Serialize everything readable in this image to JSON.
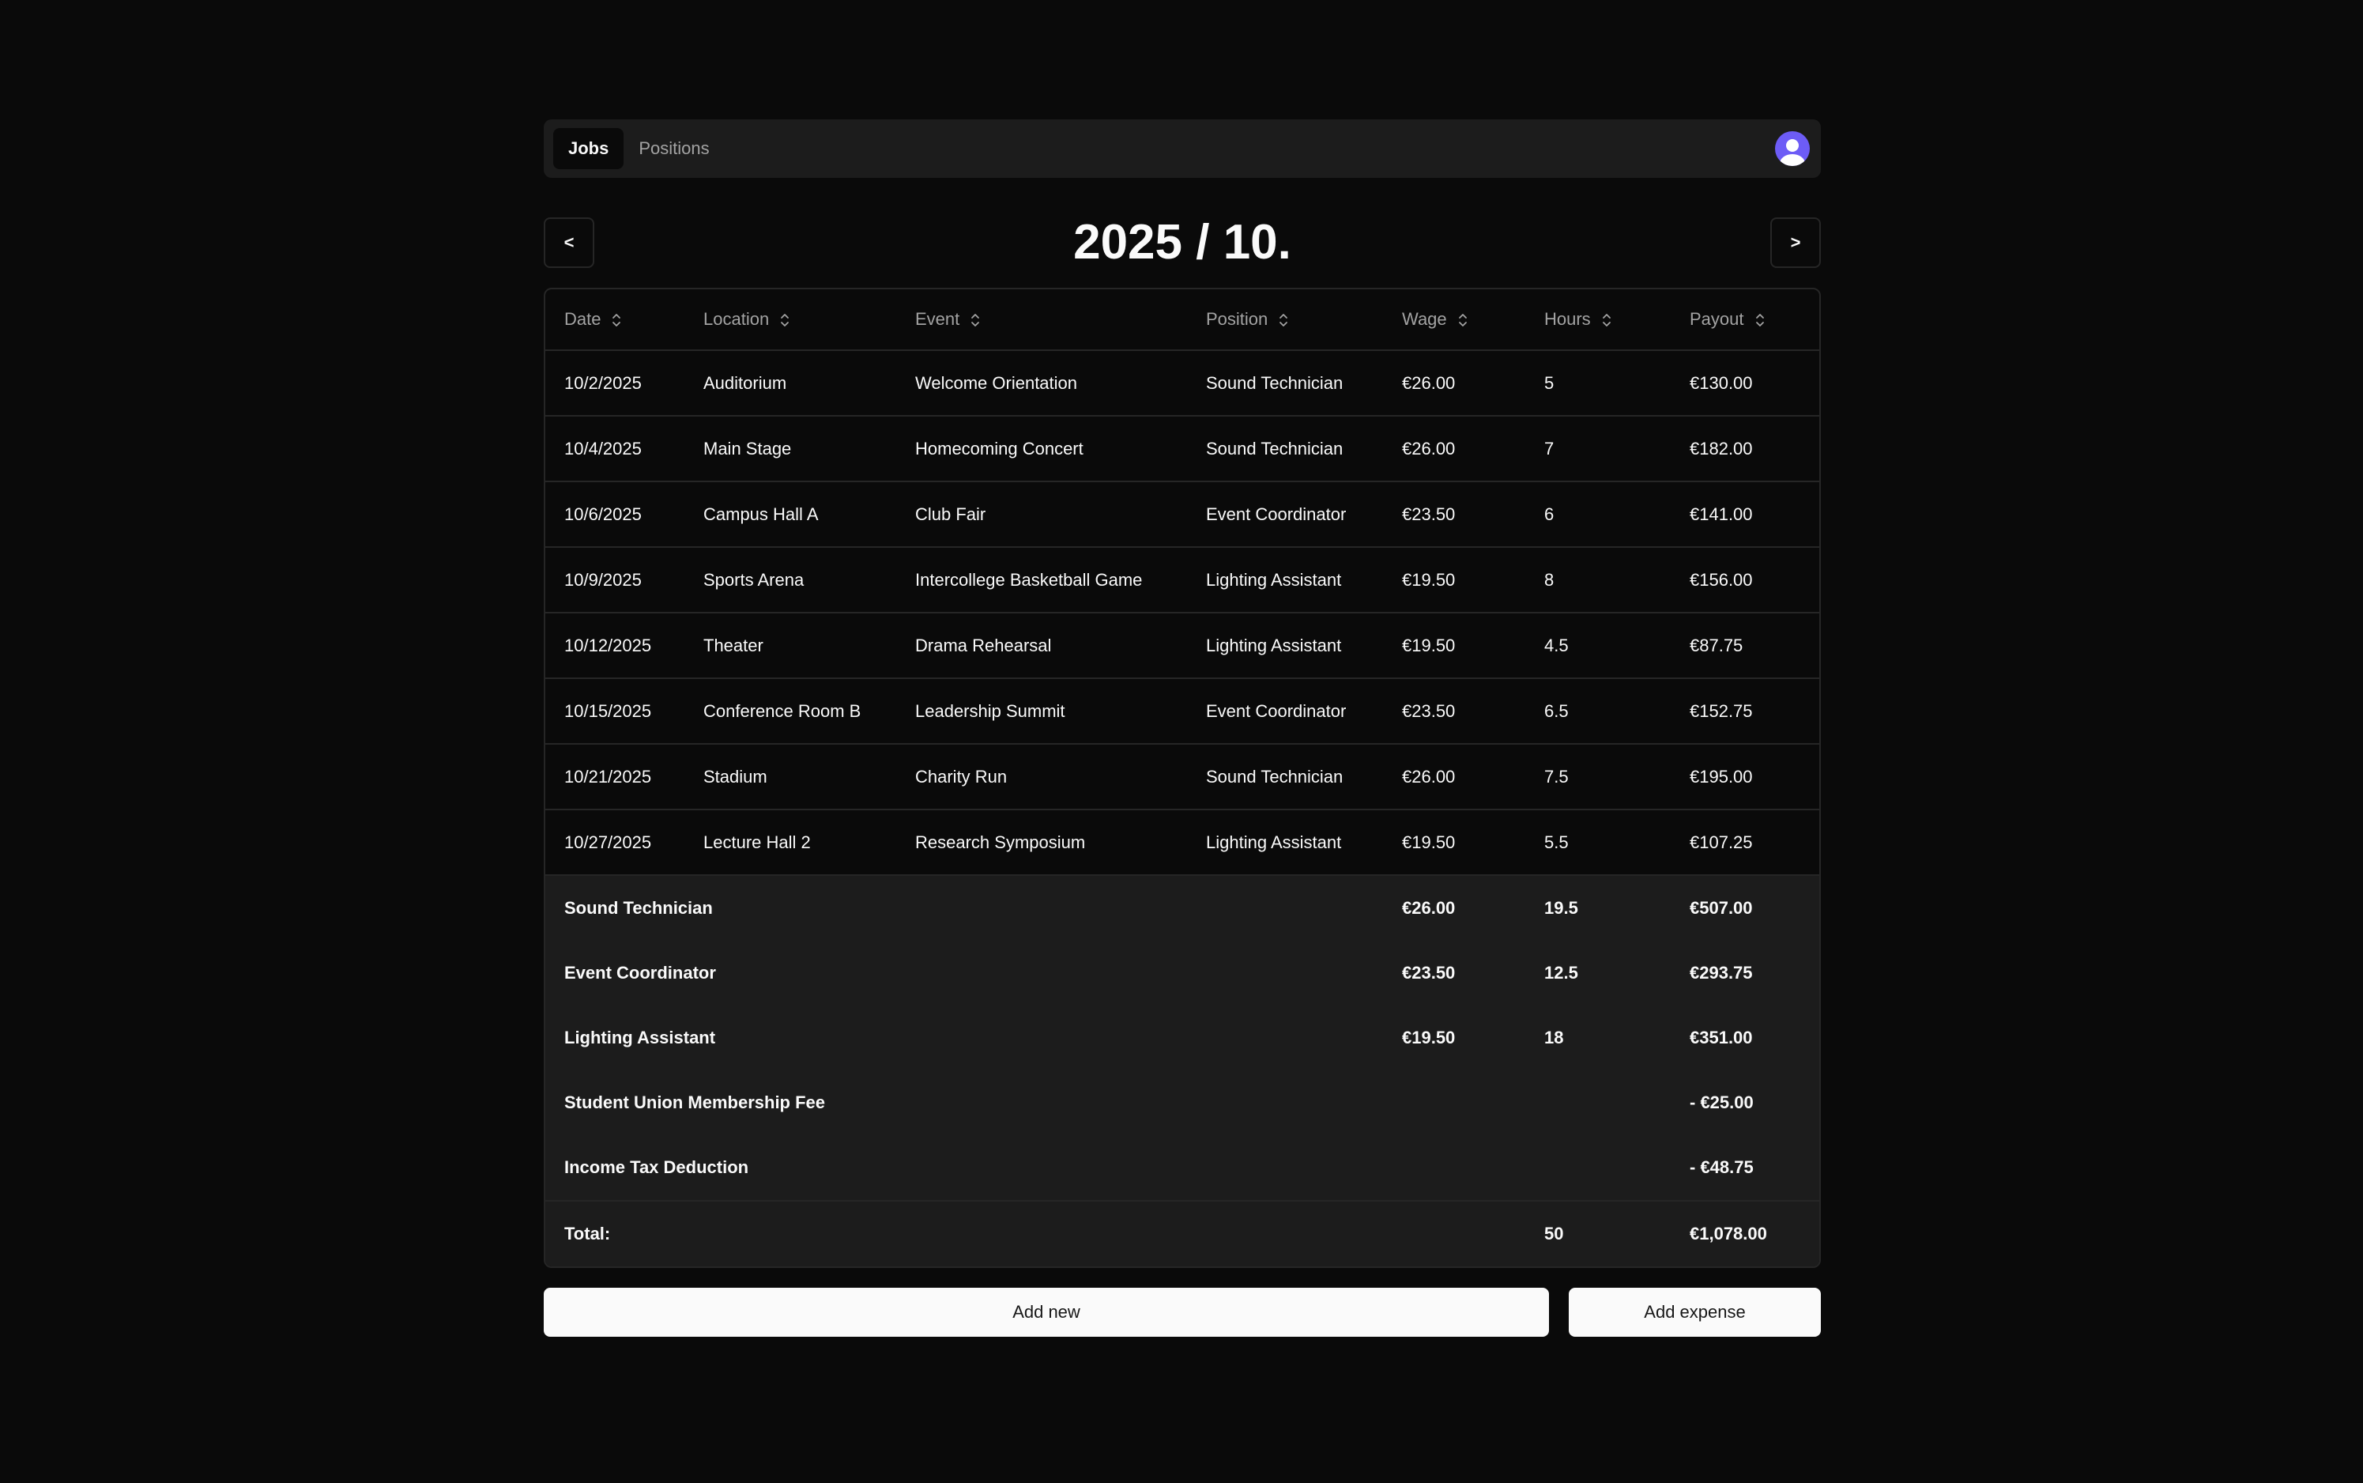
{
  "nav": {
    "tabs": [
      {
        "label": "Jobs",
        "active": true
      },
      {
        "label": "Positions",
        "active": false
      }
    ]
  },
  "month": {
    "title": "2025 / 10.",
    "prev_label": "<",
    "next_label": ">"
  },
  "table": {
    "headers": [
      "Date",
      "Location",
      "Event",
      "Position",
      "Wage",
      "Hours",
      "Payout"
    ],
    "rows": [
      [
        "10/2/2025",
        "Auditorium",
        "Welcome Orientation",
        "Sound Technician",
        "€26.00",
        "5",
        "€130.00"
      ],
      [
        "10/4/2025",
        "Main Stage",
        "Homecoming Concert",
        "Sound Technician",
        "€26.00",
        "7",
        "€182.00"
      ],
      [
        "10/6/2025",
        "Campus Hall A",
        "Club Fair",
        "Event Coordinator",
        "€23.50",
        "6",
        "€141.00"
      ],
      [
        "10/9/2025",
        "Sports Arena",
        "Intercollege Basketball Game",
        "Lighting Assistant",
        "€19.50",
        "8",
        "€156.00"
      ],
      [
        "10/12/2025",
        "Theater",
        "Drama Rehearsal",
        "Lighting Assistant",
        "€19.50",
        "4.5",
        "€87.75"
      ],
      [
        "10/15/2025",
        "Conference Room B",
        "Leadership Summit",
        "Event Coordinator",
        "€23.50",
        "6.5",
        "€152.75"
      ],
      [
        "10/21/2025",
        "Stadium",
        "Charity Run",
        "Sound Technician",
        "€26.00",
        "7.5",
        "€195.00"
      ],
      [
        "10/27/2025",
        "Lecture Hall 2",
        "Research Symposium",
        "Lighting Assistant",
        "€19.50",
        "5.5",
        "€107.25"
      ]
    ],
    "summary": [
      {
        "label": "Sound Technician",
        "wage": "€26.00",
        "hours": "19.5",
        "payout": "€507.00"
      },
      {
        "label": "Event Coordinator",
        "wage": "€23.50",
        "hours": "12.5",
        "payout": "€293.75"
      },
      {
        "label": "Lighting Assistant",
        "wage": "€19.50",
        "hours": "18",
        "payout": "€351.00"
      },
      {
        "label": "Student Union Membership Fee",
        "wage": "",
        "hours": "",
        "payout": "- €25.00"
      },
      {
        "label": "Income Tax Deduction",
        "wage": "",
        "hours": "",
        "payout": "- €48.75"
      }
    ],
    "total": {
      "label": "Total:",
      "hours": "50",
      "payout": "€1,078.00"
    }
  },
  "actions": {
    "add_new": "Add new",
    "add_expense": "Add expense"
  },
  "colors": {
    "background": "#0a0a0a",
    "panel": "#1c1c1c",
    "border": "#262626",
    "avatar": "#6d5cf6",
    "button": "#fafafa"
  }
}
